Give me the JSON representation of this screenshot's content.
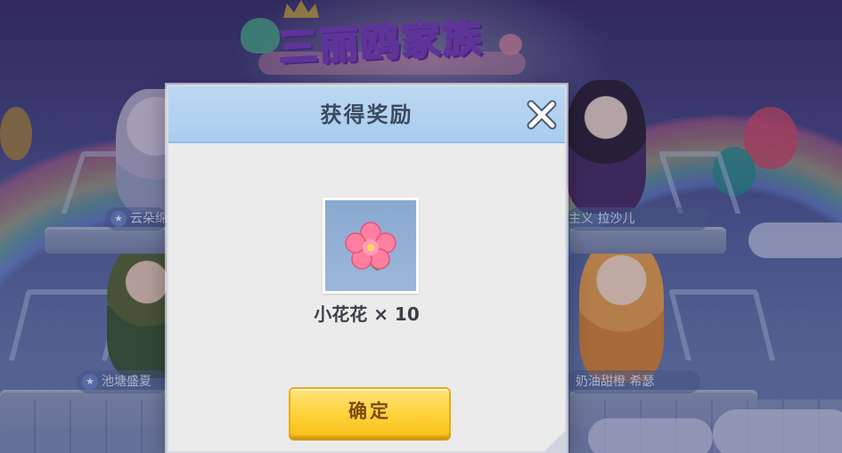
{
  "background": {
    "logo_text": "三丽鸥家族",
    "characters": [
      {
        "name": "云朵绵"
      },
      {
        "name": "池塘盛夏"
      },
      {
        "name": "主义 拉沙儿"
      },
      {
        "name": "奶油甜橙 希瑟"
      }
    ],
    "badge_glyph": "★"
  },
  "dialog": {
    "title": "获得奖励",
    "close_icon": "close-x-icon",
    "reward": {
      "icon": "pink-flower-icon",
      "name": "小花花 × 10"
    },
    "confirm_label": "确定",
    "colors": {
      "header": "#a9cdef",
      "confirm": "#ffd23a",
      "panel": "#ebebeb"
    }
  }
}
